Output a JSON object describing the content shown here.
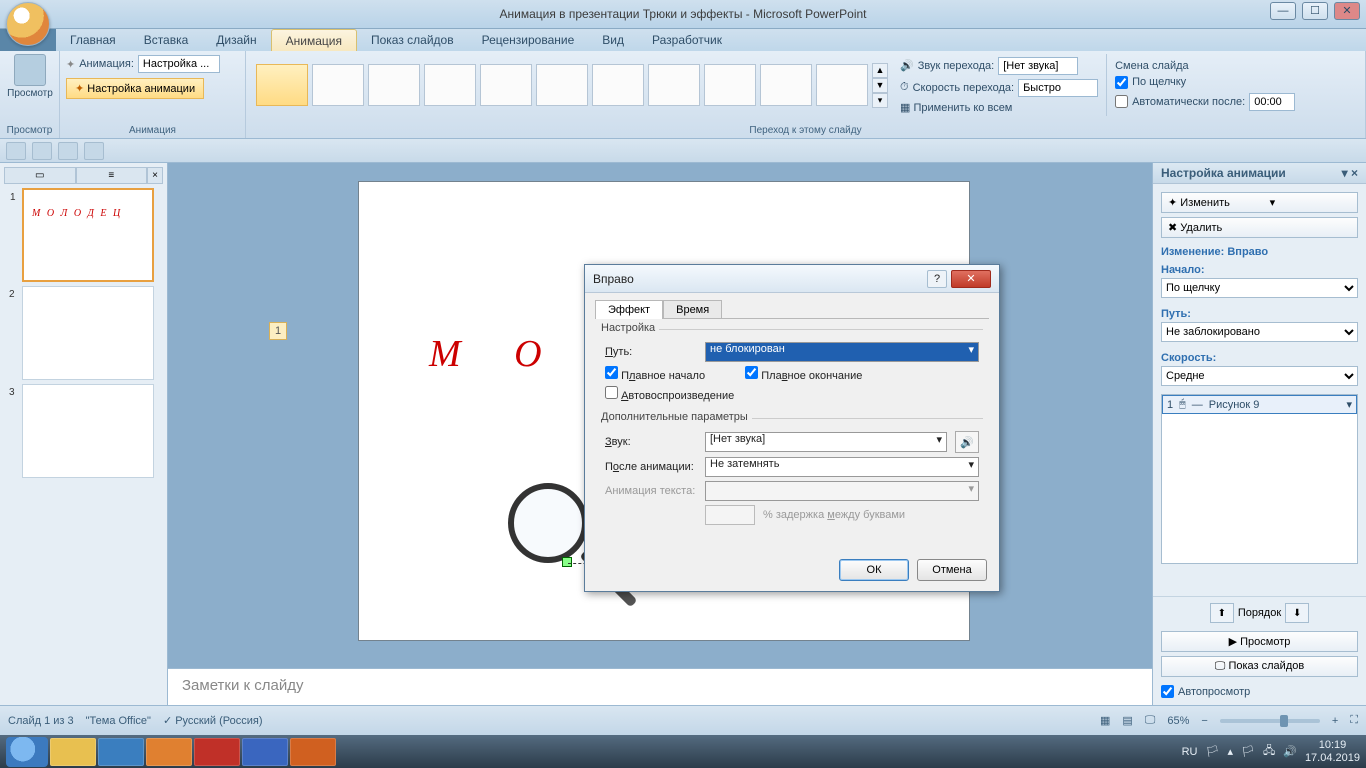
{
  "window": {
    "title": "Анимация в презентации Трюки и эффекты - Microsoft PowerPoint"
  },
  "tabs": {
    "home": "Главная",
    "insert": "Вставка",
    "design": "Дизайн",
    "animation": "Анимация",
    "slideshow": "Показ слайдов",
    "review": "Рецензирование",
    "view": "Вид",
    "developer": "Разработчик"
  },
  "ribbon": {
    "preview": "Просмотр",
    "anim_label": "Анимация:",
    "anim_value": "Настройка ...",
    "custom_anim": "Настройка анимации",
    "group_preview": "Просмотр",
    "group_anim": "Анимация",
    "group_trans": "Переход к этому слайду",
    "sound_label": "Звук перехода:",
    "sound_value": "[Нет звука]",
    "speed_label": "Скорость перехода:",
    "speed_value": "Быстро",
    "apply_all": "Применить ко всем",
    "advance_title": "Смена слайда",
    "on_click": "По щелчку",
    "auto_after": "Автоматически после:",
    "auto_time": "00:00"
  },
  "thumbs": {
    "t1": "М О Л О Д Е Ц"
  },
  "slide": {
    "text": "М О Л",
    "placeholder_num": "1"
  },
  "notes": {
    "placeholder": "Заметки к слайду"
  },
  "anim_pane": {
    "title": "Настройка анимации",
    "change": "Изменить",
    "remove": "Удалить",
    "mod_label": "Изменение: Вправо",
    "start_label": "Начало:",
    "start_value": "По щелчку",
    "path_label": "Путь:",
    "path_value": "Не заблокировано",
    "speed_label": "Скорость:",
    "speed_value": "Средне",
    "item_num": "1",
    "item_text": "Рисунок 9",
    "order": "Порядок",
    "preview": "Просмотр",
    "slideshow": "Показ слайдов",
    "autopreview": "Автопросмотр"
  },
  "dialog": {
    "title": "Вправо",
    "tab_effect": "Эффект",
    "tab_time": "Время",
    "group_settings": "Настройка",
    "path_label": "Путь:",
    "path_value": "не блокирован",
    "smooth_start": "Плавное начало",
    "smooth_end": "Плавное окончание",
    "autorev": "Автовоспроизведение",
    "group_extra": "Дополнительные параметры",
    "sound_label": "Звук:",
    "sound_value": "[Нет звука]",
    "after_label": "После анимации:",
    "after_value": "Не затемнять",
    "text_label": "Анимация текста:",
    "delay_label": "% задержка между буквами",
    "ok": "ОК",
    "cancel": "Отмена"
  },
  "status": {
    "slide": "Слайд 1 из 3",
    "theme": "\"Тема Office\"",
    "lang": "Русский (Россия)",
    "zoom": "65%"
  },
  "taskbar": {
    "lang": "RU",
    "time": "10:19",
    "date": "17.04.2019"
  }
}
